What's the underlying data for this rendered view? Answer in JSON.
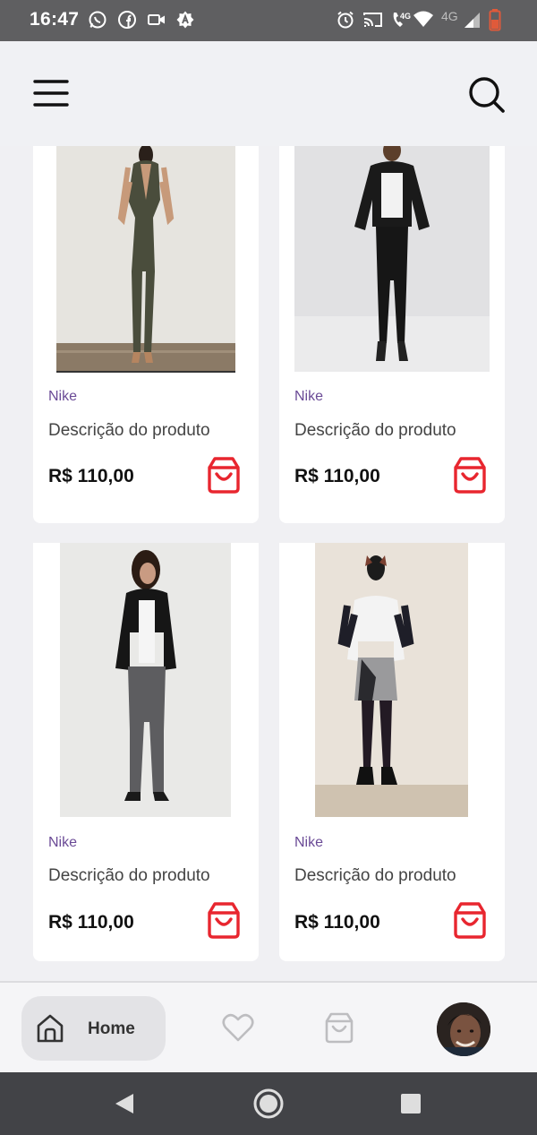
{
  "status_bar": {
    "time": "16:47",
    "left_icons": [
      "whatsapp-icon",
      "facebook-icon",
      "video-camera-icon",
      "app-notification-icon"
    ],
    "right_icons": [
      "alarm-icon",
      "cast-icon",
      "wifi-call-icon",
      "wifi-icon",
      "signal-4g-icon",
      "battery-low-icon"
    ],
    "network_label_1": "4G",
    "network_label_2": "4G",
    "battery_color": "#e05a3a"
  },
  "app_bar": {
    "menu_icon": "hamburger-menu-icon",
    "search_icon": "search-icon"
  },
  "products": [
    {
      "brand": "Nike",
      "description": "Descrição do produto",
      "price": "R$ 110,00",
      "image": "olive jumpsuit outfit"
    },
    {
      "brand": "Nike",
      "description": "Descrição do produto",
      "price": "R$ 110,00",
      "image": "black leather jacket outfit"
    },
    {
      "brand": "Nike",
      "description": "Descrição do produto",
      "price": "R$ 110,00",
      "image": "black blazer grey trousers outfit"
    },
    {
      "brand": "Nike",
      "description": "Descrição do produto",
      "price": "R$ 110,00",
      "image": "grey skirt black tights outfit"
    }
  ],
  "colors": {
    "brand_text": "#6a4a96",
    "cart_icon": "#e8262f",
    "background": "#f0f0f3"
  },
  "bottom_nav": {
    "home_label": "Home",
    "home_icon": "home-icon",
    "favorites_icon": "heart-icon",
    "bag_icon": "shopping-bag-icon"
  },
  "system_nav": [
    "back-icon",
    "home-circle-icon",
    "recents-square-icon"
  ]
}
